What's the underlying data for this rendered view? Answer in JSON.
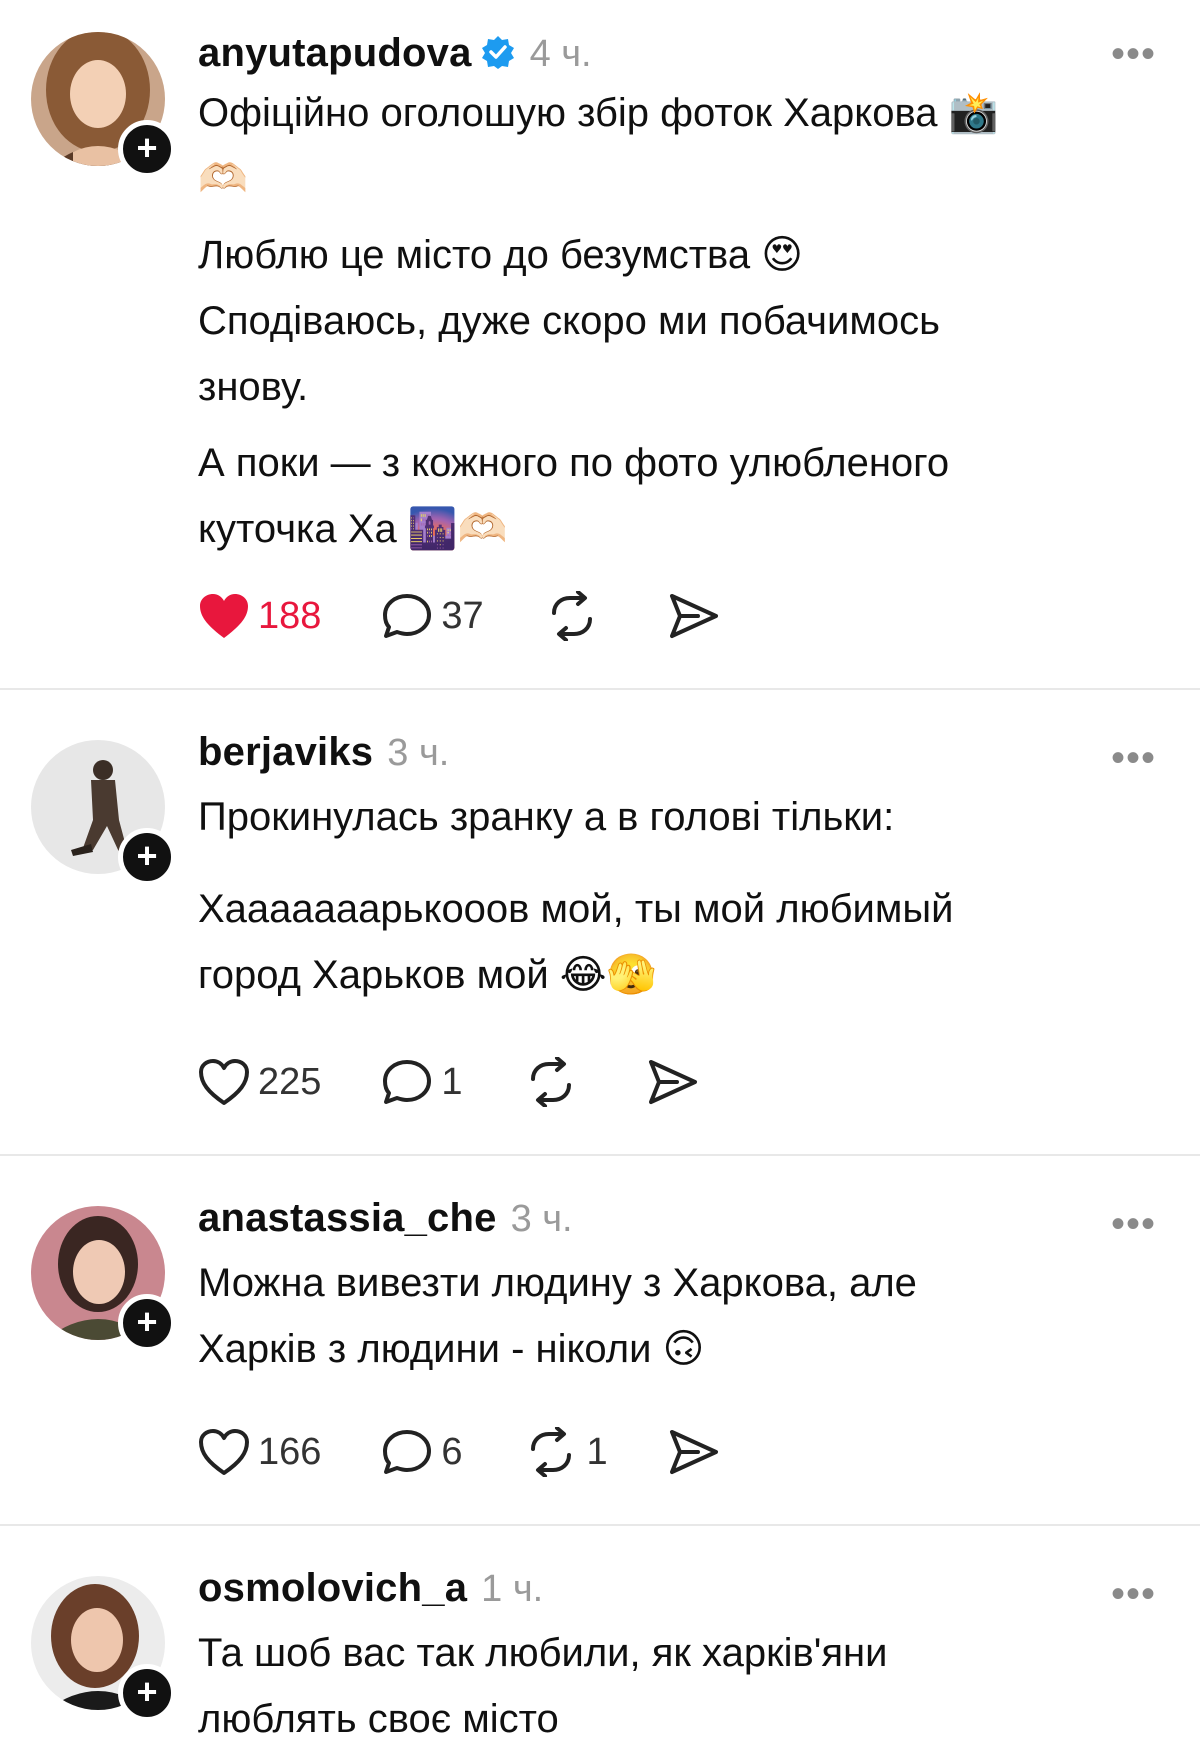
{
  "posts": [
    {
      "username": "anyutapudova",
      "verified": true,
      "time": "4 ч.",
      "more": "•••",
      "lines": [
        "Офіційно оголошую збір фоток Харкова 📸",
        "🫶🏻",
        "Люблю це місто до безумства 😍",
        "Сподіваюсь, дуже скоро ми побачимось",
        "знову.",
        "А поки — з кожного по фото улюбленого",
        "куточка Ха 🌆🫶🏻"
      ],
      "likes": "188",
      "liked": true,
      "comments": "37",
      "reposts": ""
    },
    {
      "username": "berjaviks",
      "verified": false,
      "time": "3 ч.",
      "more": "•••",
      "lines": [
        "Прокинулась зранку а в голові тільки:",
        "Хааааааарькооов мой, ты мой любимый",
        "город Харьков мой 😂🫣"
      ],
      "likes": "225",
      "liked": false,
      "comments": "1",
      "reposts": ""
    },
    {
      "username": "anastassia_che",
      "verified": false,
      "time": "3 ч.",
      "more": "•••",
      "lines": [
        "Можна вивезти людину з Харкова, але",
        "Харків з людини - ніколи 🙃"
      ],
      "likes": "166",
      "liked": false,
      "comments": "6",
      "reposts": "1"
    },
    {
      "username": "osmolovich_a",
      "verified": false,
      "time": "1 ч.",
      "more": "•••",
      "lines": [
        "Та шоб вас так любили, як харків'яни",
        "люблять своє місто"
      ]
    }
  ],
  "icons": {
    "follow": "+",
    "like": "heart-icon",
    "comment": "comment-icon",
    "repost": "repost-icon",
    "share": "share-icon",
    "verified": "verified-badge-icon"
  },
  "colors": {
    "like_active": "#e8173d",
    "verified": "#1d9bf0",
    "muted": "#9a9a9a",
    "divider": "#e8e8e8"
  }
}
